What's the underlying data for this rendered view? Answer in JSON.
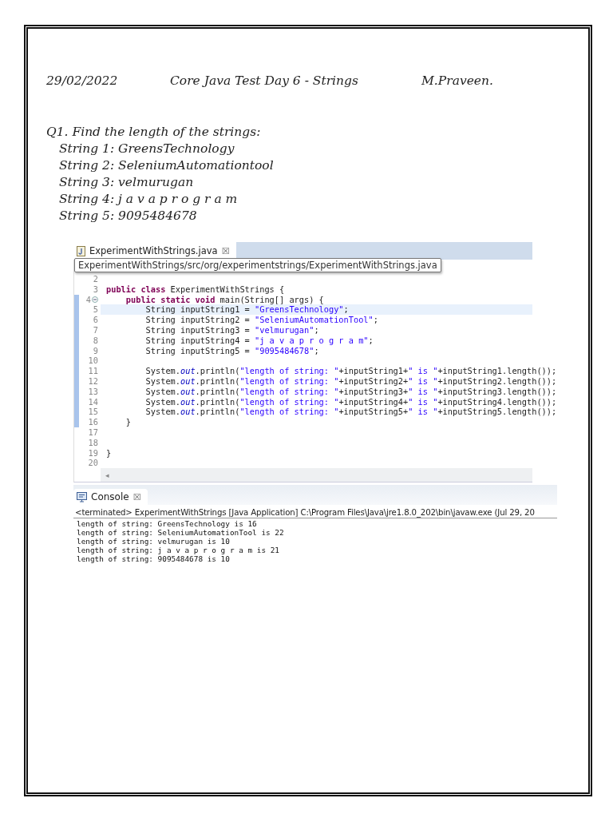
{
  "header": {
    "date": "29/02/2022",
    "title": "Core Java Test Day 6 -  Strings",
    "author": "M.Praveen."
  },
  "question": {
    "title": "Q1. Find the length  of the strings:",
    "items": [
      "String 1: GreensTechnology",
      "String 2: SeleniumAutomationtool",
      "String 3: velmurugan",
      "String 4: j a v a p r o g r a m",
      "String 5: 9095484678"
    ]
  },
  "editor": {
    "tab": {
      "label": "ExperimentWithStrings.java",
      "close": "☒"
    },
    "tooltip": "ExperimentWithStrings/src/org/experimentstrings/ExperimentWithStrings.java",
    "lines": [
      {
        "number": "2",
        "marked": false,
        "highlighted": false
      },
      {
        "number": "3",
        "marked": false,
        "highlighted": false,
        "tokens": [
          {
            "kind": "keyword",
            "text": "public class"
          },
          {
            "kind": "plain",
            "text": " ExperimentWithStrings {"
          }
        ]
      },
      {
        "number": "4",
        "marked": true,
        "highlighted": false,
        "fold": true,
        "tokens": [
          {
            "kind": "keyword",
            "text": "    public static void"
          },
          {
            "kind": "plain",
            "text": " main(String[] args) {"
          }
        ]
      },
      {
        "number": "5",
        "marked": true,
        "highlighted": true,
        "tokens": [
          {
            "kind": "plain",
            "text": "        String inputString1 = "
          },
          {
            "kind": "string",
            "text": "\"GreensTechnology\""
          },
          {
            "kind": "plain",
            "text": ";"
          }
        ]
      },
      {
        "number": "6",
        "marked": true,
        "highlighted": false,
        "tokens": [
          {
            "kind": "plain",
            "text": "        String inputString2 = "
          },
          {
            "kind": "string",
            "text": "\"SeleniumAutomationTool\""
          },
          {
            "kind": "plain",
            "text": ";"
          }
        ]
      },
      {
        "number": "7",
        "marked": true,
        "highlighted": false,
        "tokens": [
          {
            "kind": "plain",
            "text": "        String inputString3 = "
          },
          {
            "kind": "string",
            "text": "\"velmurugan\""
          },
          {
            "kind": "plain",
            "text": ";"
          }
        ]
      },
      {
        "number": "8",
        "marked": true,
        "highlighted": false,
        "tokens": [
          {
            "kind": "plain",
            "text": "        String inputString4 = "
          },
          {
            "kind": "string",
            "text": "\"j a v a p r o g r a m\""
          },
          {
            "kind": "plain",
            "text": ";"
          }
        ]
      },
      {
        "number": "9",
        "marked": true,
        "highlighted": false,
        "tokens": [
          {
            "kind": "plain",
            "text": "        String inputString5 = "
          },
          {
            "kind": "string",
            "text": "\"9095484678\""
          },
          {
            "kind": "plain",
            "text": ";"
          }
        ]
      },
      {
        "number": "10",
        "marked": true,
        "highlighted": false
      },
      {
        "number": "11",
        "marked": true,
        "highlighted": false,
        "tokens": [
          {
            "kind": "plain",
            "text": "        System."
          },
          {
            "kind": "field",
            "text": "out"
          },
          {
            "kind": "plain",
            "text": ".println("
          },
          {
            "kind": "string",
            "text": "\"length of string: \""
          },
          {
            "kind": "plain",
            "text": "+inputString1+"
          },
          {
            "kind": "string",
            "text": "\" is \""
          },
          {
            "kind": "plain",
            "text": "+inputString1.length());"
          }
        ]
      },
      {
        "number": "12",
        "marked": true,
        "highlighted": false,
        "tokens": [
          {
            "kind": "plain",
            "text": "        System."
          },
          {
            "kind": "field",
            "text": "out"
          },
          {
            "kind": "plain",
            "text": ".println("
          },
          {
            "kind": "string",
            "text": "\"length of string: \""
          },
          {
            "kind": "plain",
            "text": "+inputString2+"
          },
          {
            "kind": "string",
            "text": "\" is \""
          },
          {
            "kind": "plain",
            "text": "+inputString2.length());"
          }
        ]
      },
      {
        "number": "13",
        "marked": true,
        "highlighted": false,
        "tokens": [
          {
            "kind": "plain",
            "text": "        System."
          },
          {
            "kind": "field",
            "text": "out"
          },
          {
            "kind": "plain",
            "text": ".println("
          },
          {
            "kind": "string",
            "text": "\"length of string: \""
          },
          {
            "kind": "plain",
            "text": "+inputString3+"
          },
          {
            "kind": "string",
            "text": "\" is \""
          },
          {
            "kind": "plain",
            "text": "+inputString3.length());"
          }
        ]
      },
      {
        "number": "14",
        "marked": true,
        "highlighted": false,
        "tokens": [
          {
            "kind": "plain",
            "text": "        System."
          },
          {
            "kind": "field",
            "text": "out"
          },
          {
            "kind": "plain",
            "text": ".println("
          },
          {
            "kind": "string",
            "text": "\"length of string: \""
          },
          {
            "kind": "plain",
            "text": "+inputString4+"
          },
          {
            "kind": "string",
            "text": "\" is \""
          },
          {
            "kind": "plain",
            "text": "+inputString4.length());"
          }
        ]
      },
      {
        "number": "15",
        "marked": true,
        "highlighted": false,
        "tokens": [
          {
            "kind": "plain",
            "text": "        System."
          },
          {
            "kind": "field",
            "text": "out"
          },
          {
            "kind": "plain",
            "text": ".println("
          },
          {
            "kind": "string",
            "text": "\"length of string: \""
          },
          {
            "kind": "plain",
            "text": "+inputString5+"
          },
          {
            "kind": "string",
            "text": "\" is \""
          },
          {
            "kind": "plain",
            "text": "+inputString5.length());"
          }
        ]
      },
      {
        "number": "16",
        "marked": true,
        "highlighted": false,
        "tokens": [
          {
            "kind": "plain",
            "text": "    }"
          }
        ]
      },
      {
        "number": "17",
        "marked": false,
        "highlighted": false
      },
      {
        "number": "18",
        "marked": false,
        "highlighted": false
      },
      {
        "number": "19",
        "marked": false,
        "highlighted": false,
        "tokens": [
          {
            "kind": "plain",
            "text": "}"
          }
        ]
      },
      {
        "number": "20",
        "marked": false,
        "highlighted": false
      }
    ],
    "scroll_arrow": "◂"
  },
  "console": {
    "tab": {
      "label": "Console",
      "close": "☒"
    },
    "status": "<terminated> ExperimentWithStrings [Java Application] C:\\Program Files\\Java\\jre1.8.0_202\\bin\\javaw.exe (Jul 29, 20",
    "output": [
      "length of string: GreensTechnology is 16",
      "length of string: SeleniumAutomationTool is 22",
      "length of string: velmurugan is 10",
      "length of string: j a v a p r o g r a m is 21",
      "length of string: 9095484678 is 10"
    ]
  }
}
